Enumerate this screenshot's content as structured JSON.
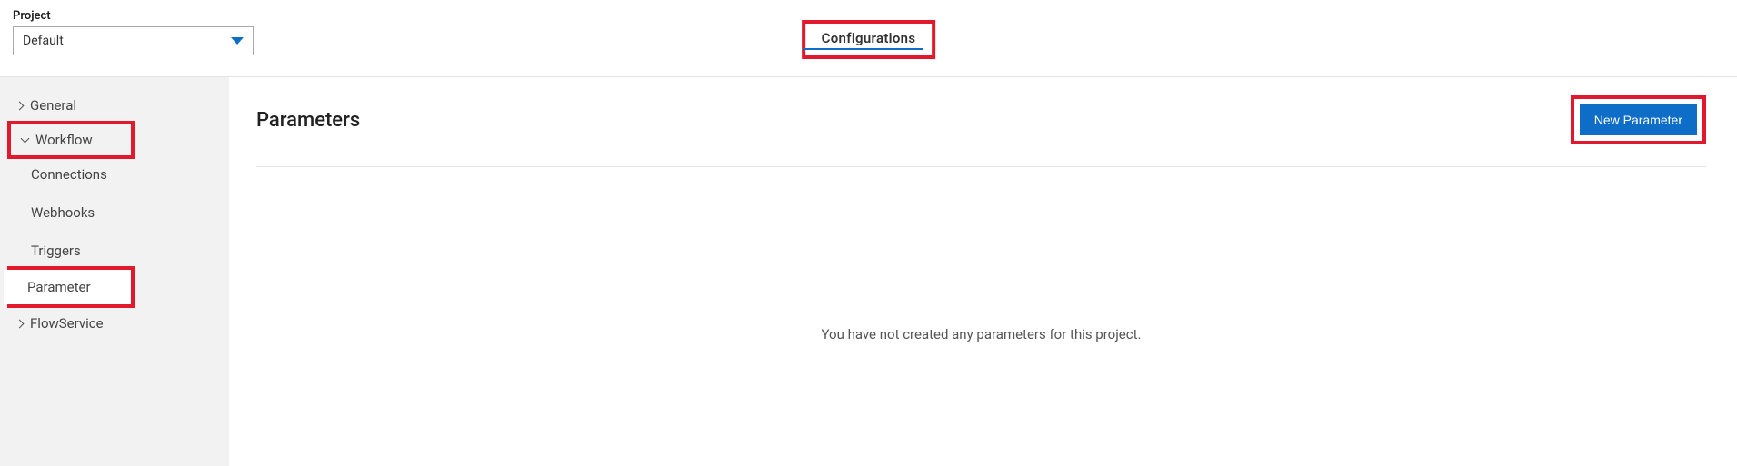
{
  "project": {
    "label": "Project",
    "value": "Default"
  },
  "tab": {
    "label": "Configurations"
  },
  "sidebar": {
    "general": "General",
    "workflow": "Workflow",
    "connections": "Connections",
    "webhooks": "Webhooks",
    "triggers": "Triggers",
    "parameter": "Parameter",
    "flowservice": "FlowService"
  },
  "page": {
    "title": "Parameters",
    "newButton": "New Parameter",
    "emptyMessage": "You have not created any parameters for this project."
  }
}
